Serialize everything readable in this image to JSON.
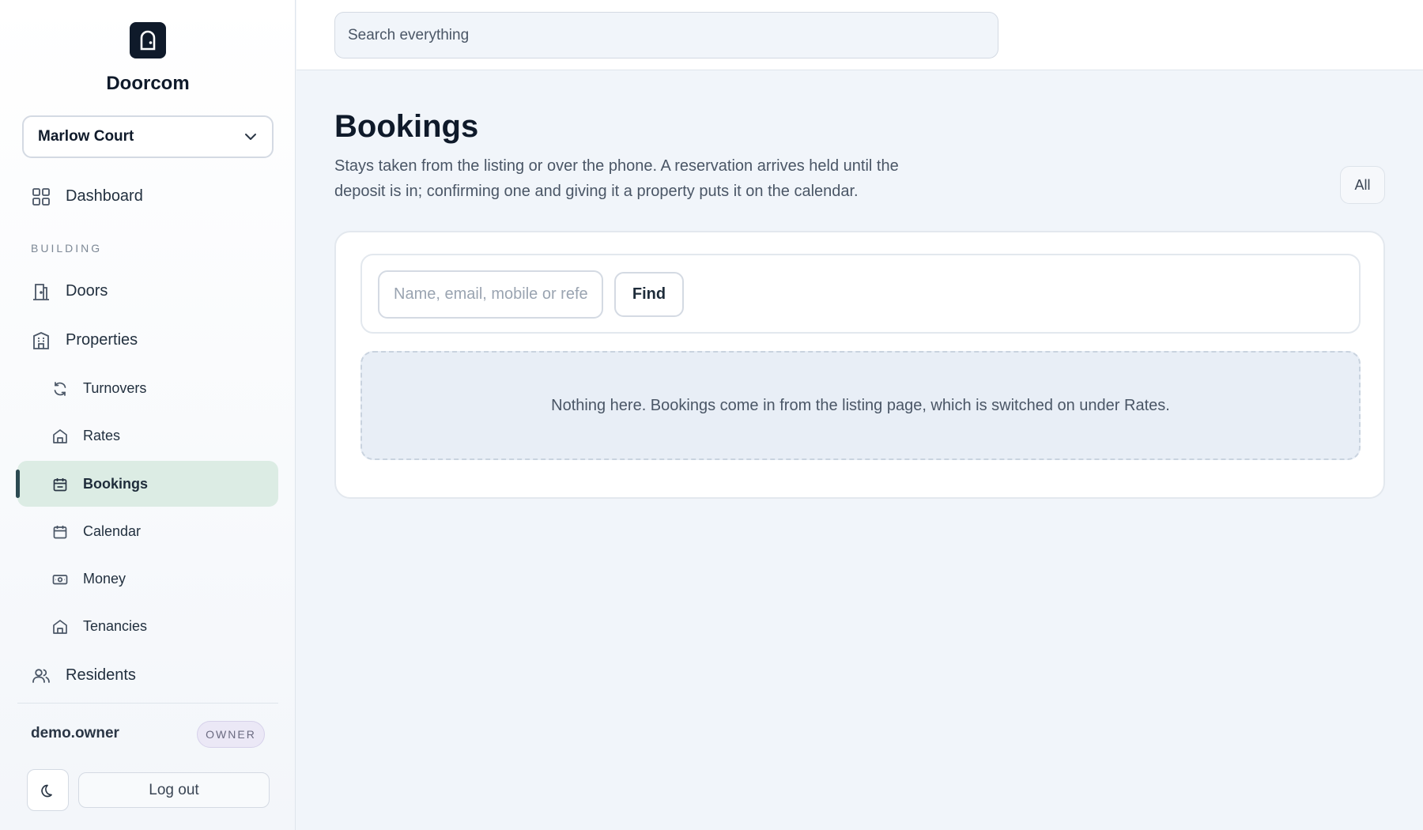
{
  "brand": {
    "name": "Doorcom",
    "logo_icon": "door-icon"
  },
  "site_selector": {
    "value": "Marlow Court"
  },
  "sidebar": {
    "section_label": "BUILDING",
    "items": [
      {
        "label": "Dashboard",
        "icon": "grid-icon"
      },
      {
        "label": "Doors",
        "icon": "door-icon"
      },
      {
        "label": "Properties",
        "icon": "building-icon"
      },
      {
        "label": "Turnovers",
        "icon": "refresh-icon"
      },
      {
        "label": "Rates",
        "icon": "house-icon"
      },
      {
        "label": "Bookings",
        "icon": "calendar-check-icon",
        "active": true
      },
      {
        "label": "Calendar",
        "icon": "calendar-icon"
      },
      {
        "label": "Money",
        "icon": "banknote-icon"
      },
      {
        "label": "Tenancies",
        "icon": "house-icon"
      },
      {
        "label": "Residents",
        "icon": "users-icon"
      }
    ]
  },
  "user": {
    "name": "demo.owner",
    "role": "OWNER"
  },
  "footer": {
    "logout_label": "Log out",
    "theme_icon": "moon-icon"
  },
  "header": {
    "search_placeholder": "Search everything"
  },
  "page": {
    "title": "Bookings",
    "description": "Stays taken from the listing or over the phone. A reservation arrives held until the deposit is in; confirming one and giving it a property puts it on the calendar.",
    "filter_label": "All"
  },
  "search": {
    "placeholder": "Name, email, mobile or reference",
    "button_label": "Find"
  },
  "empty_state": {
    "message": "Nothing here. Bookings come in from the listing page, which is switched on under Rates."
  },
  "colors": {
    "active_bg": "#dcece4",
    "active_bar": "#2c4a52",
    "brand_dark": "#0f1a2a",
    "page_bg": "#f1f5fa"
  }
}
